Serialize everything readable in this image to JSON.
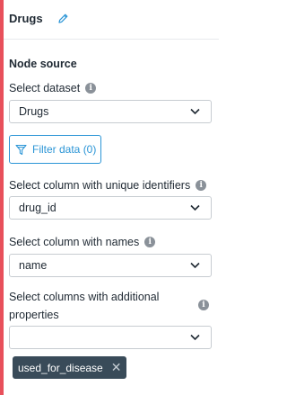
{
  "header": {
    "title": "Drugs",
    "edit_icon": "pencil-icon"
  },
  "section": {
    "title": "Node source"
  },
  "dataset": {
    "label": "Select dataset",
    "value": "Drugs"
  },
  "filter": {
    "label": "Filter data (0)",
    "icon": "filter-icon"
  },
  "id_column": {
    "label": "Select column with unique identifiers",
    "value": "drug_id"
  },
  "name_column": {
    "label": "Select column with names",
    "value": "name"
  },
  "properties": {
    "label": "Select columns with additional properties",
    "value": "",
    "tags": [
      {
        "label": "used_for_disease",
        "remove_icon": "close-icon"
      }
    ]
  },
  "colors": {
    "accent": "#e8505b",
    "primary": "#2b95d6",
    "tag_bg": "#394b59"
  }
}
